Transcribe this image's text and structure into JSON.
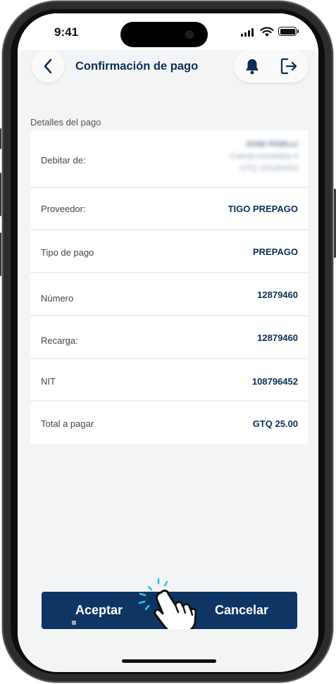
{
  "status_bar": {
    "time": "9:41"
  },
  "header": {
    "title": "Confirmación de pago"
  },
  "section": {
    "label": "Detalles del pago"
  },
  "rows": [
    {
      "label": "Debitar de:",
      "blurred_lines": [
        "JOSE FIGELLI",
        "Cuenta monetaria 4",
        "GTQ 102183403"
      ]
    },
    {
      "label": "Proveedor:",
      "value": "TIGO PREPAGO"
    },
    {
      "label": "Tipo de pago",
      "value": "PREPAGO"
    },
    {
      "label": "Número",
      "value": "12879460"
    },
    {
      "label": "Recarga:",
      "value": "12879460"
    },
    {
      "label": "NIT",
      "value": "108796452"
    },
    {
      "label": "Total a pagar",
      "value": "GTQ 25.00"
    }
  ],
  "buttons": {
    "accept": "Aceptar",
    "cancel": "Cancelar"
  },
  "icons": {
    "back": "chevron-left-icon",
    "notifications": "bell-icon",
    "logout": "logout-icon",
    "cursor": "hand-pointer-icon"
  },
  "colors": {
    "brand_navy": "#0e3563",
    "title_text": "#0b2f57",
    "background": "#f3f4f5",
    "tap_highlight": "#2ec5f0"
  }
}
